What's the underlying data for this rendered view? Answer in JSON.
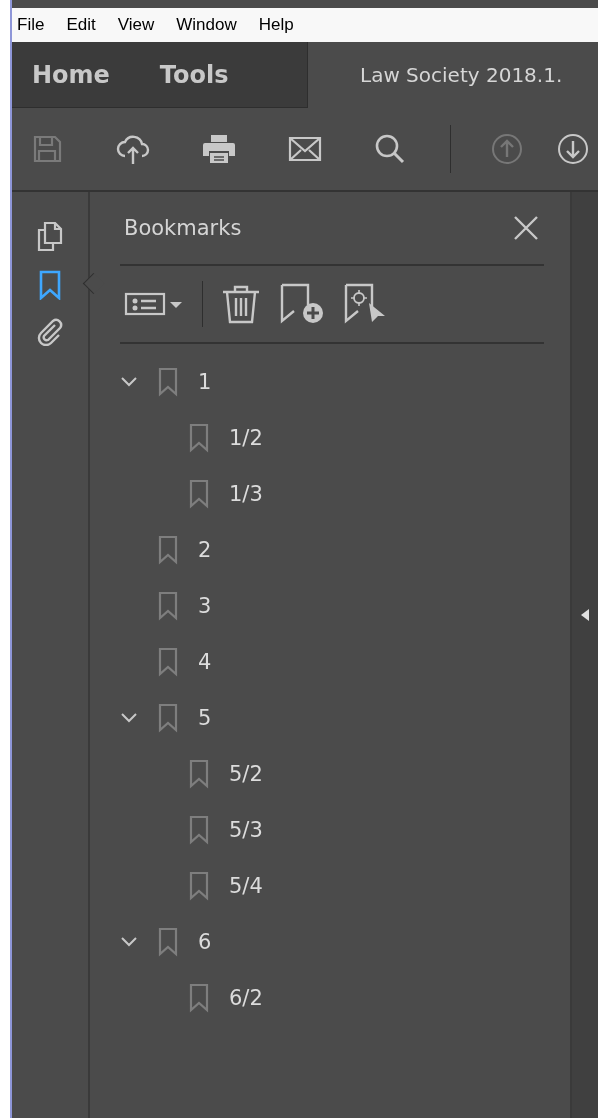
{
  "menu_bar": [
    "File",
    "Edit",
    "View",
    "Window",
    "Help"
  ],
  "tabs": [
    {
      "label": "Home",
      "selected": false
    },
    {
      "label": "Tools",
      "selected": false
    },
    {
      "label": "Law Society 2018.1.",
      "selected": true
    }
  ],
  "panel": {
    "title": "Bookmarks",
    "bookmarks": [
      {
        "label": "1",
        "expanded": true,
        "children": [
          {
            "label": "1/2"
          },
          {
            "label": "1/3"
          }
        ]
      },
      {
        "label": "2"
      },
      {
        "label": "3"
      },
      {
        "label": "4"
      },
      {
        "label": "5",
        "expanded": true,
        "children": [
          {
            "label": "5/2"
          },
          {
            "label": "5/3"
          },
          {
            "label": "5/4"
          }
        ]
      },
      {
        "label": "6",
        "expanded": true,
        "children": [
          {
            "label": "6/2"
          }
        ]
      }
    ]
  }
}
